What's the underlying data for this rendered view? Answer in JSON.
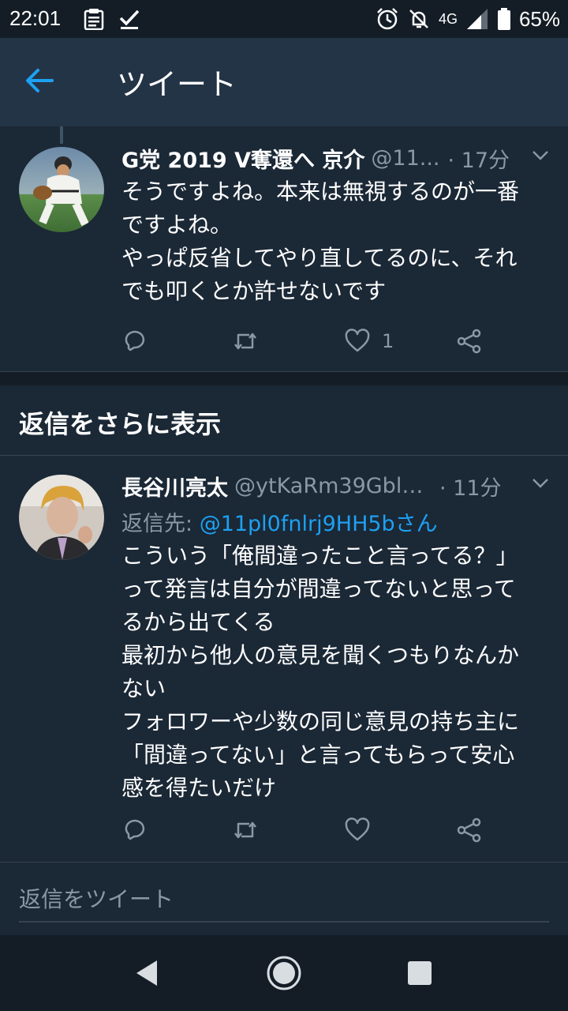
{
  "status_bar": {
    "time": "22:01",
    "network": "4G",
    "battery_percent": "65%",
    "icons": [
      "clipboard-icon",
      "check-icon",
      "alarm-icon",
      "notifications-off-icon",
      "signal-icon",
      "battery-icon"
    ]
  },
  "header": {
    "title": "ツイート",
    "back_icon": "arrow-left-icon"
  },
  "tweets": [
    {
      "name": "G党 2019 V奪還へ 京介",
      "handle": "@11...",
      "time": "· 17分",
      "text": "そうですよね。本来は無視するのが一番\nですよね。\nやっぱ反省してやり直してるのに、それ\nでも叩くとか許せないです",
      "like_count": "1"
    },
    {
      "name": "長谷川亮太",
      "handle": "@ytKaRm39Gbl0...",
      "time": "· 11分",
      "reply_label": "返信先: ",
      "reply_mention": "@11pl0fnlrj9HH5bさん",
      "text": "こういう「俺間違ったこと言ってる？」\nって発言は自分が間違ってないと思って\nるから出てくる\n最初から他人の意見を聞くつもりなんか\nない\nフォロワーや少数の同じ意見の持ち主に\n「間違ってない」と言ってもらって安心\n感を得たいだけ",
      "like_count": ""
    }
  ],
  "show_more": {
    "label": "返信をさらに表示"
  },
  "compose": {
    "placeholder": "返信をツイート"
  },
  "colors": {
    "background": "#141d26",
    "card": "#1b2836",
    "header": "#243447",
    "accent": "#1da1f2",
    "secondary_text": "#8899a6"
  }
}
